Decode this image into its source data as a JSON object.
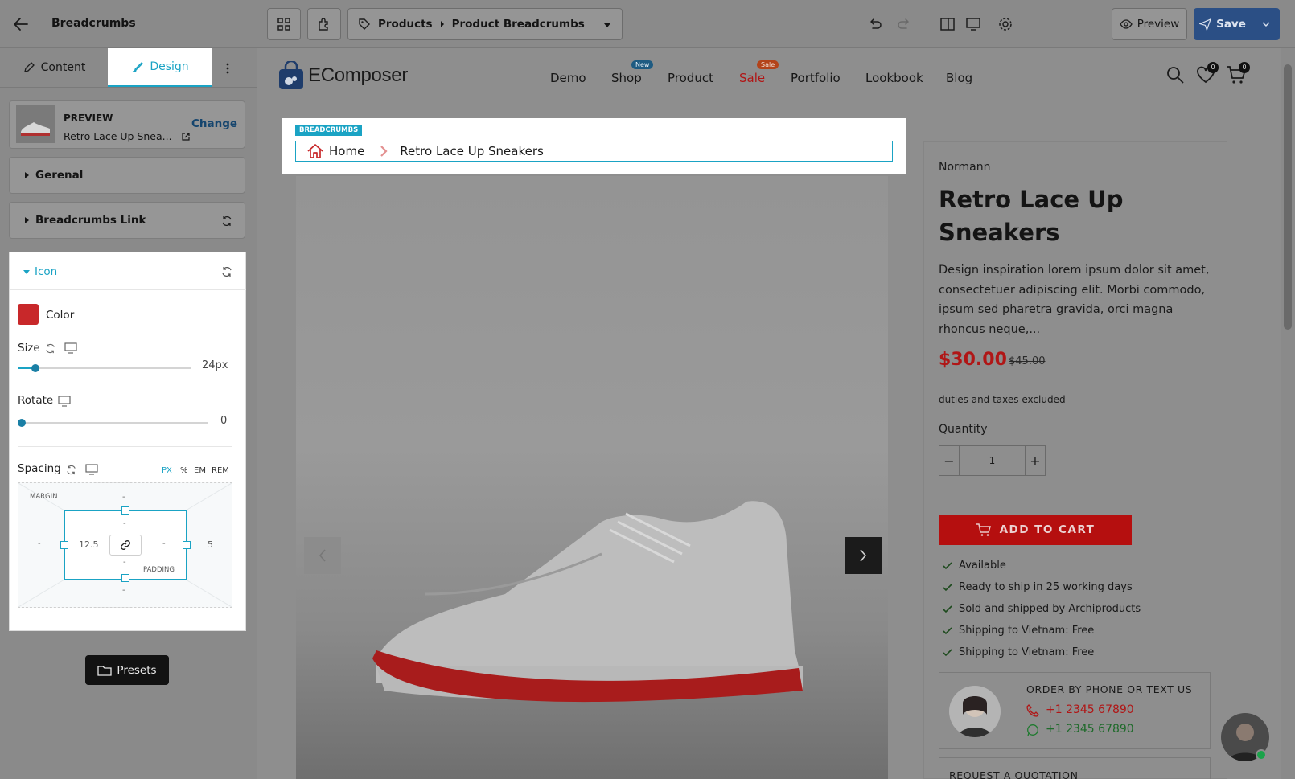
{
  "topbar": {
    "page_title": "Breadcrumbs",
    "breadcrumb_root": "Products",
    "breadcrumb_current": "Product Breadcrumbs",
    "preview_label": "Preview",
    "save_label": "Save"
  },
  "sidebar": {
    "tabs": [
      {
        "label": "Content"
      },
      {
        "label": "Design"
      }
    ],
    "preview": {
      "heading": "PREVIEW",
      "product_name": "Retro Lace Up Snea...",
      "change_label": "Change"
    },
    "sections": [
      {
        "label": "Gerenal"
      },
      {
        "label": "Breadcrumbs Link"
      },
      {
        "label": "Icon"
      }
    ],
    "icon": {
      "color_label": "Color",
      "color_value": "#c8282a",
      "size_label": "Size",
      "size_value": "24px",
      "size_fraction": 0.1,
      "rotate_label": "Rotate",
      "rotate_value": "0",
      "rotate_fraction": 0,
      "spacing_label": "Spacing",
      "units": [
        "PX",
        "%",
        "EM",
        "REM"
      ],
      "active_unit": "PX",
      "margin_label": "MARGIN",
      "padding_label": "PADDING",
      "margin_top": "-",
      "margin_bottom": "-",
      "margin_left": "-",
      "margin_right": "5",
      "padding_top": "-",
      "padding_bottom": "-",
      "padding_left": "12.5",
      "padding_right": "-"
    },
    "presets_label": "Presets"
  },
  "store": {
    "logo_text": "EComposer",
    "nav": [
      {
        "label": "Demo"
      },
      {
        "label": "Shop",
        "badge": "New"
      },
      {
        "label": "Product"
      },
      {
        "label": "Sale",
        "badge": "Sale"
      },
      {
        "label": "Portfolio"
      },
      {
        "label": "Lookbook"
      },
      {
        "label": "Blog"
      }
    ],
    "wishlist_count": "0",
    "cart_count": "0"
  },
  "breadcrumbs_widget": {
    "tag": "BREADCRUMBS",
    "home_label": "Home",
    "current_label": "Retro Lace Up Sneakers"
  },
  "product": {
    "vendor": "Normann",
    "title_line1": "Retro Lace Up",
    "title_line2": "Sneakers",
    "description": [
      "Design inspiration lorem ipsum dolor sit amet,",
      "consectetuer adipiscing elit. Morbi commodo,",
      "ipsum sed pharetra gravida, orci magna",
      "rhoncus neque,..."
    ],
    "price": "$30.00",
    "compare_price": "$45.00",
    "tax_note": "duties and taxes excluded",
    "quantity_label": "Quantity",
    "quantity_value": "1",
    "add_to_cart_label": "ADD TO CART",
    "features": [
      "Available",
      "Ready to ship in 25 working days",
      "Sold and shipped by Archiproducts",
      "Shipping to Vietnam: Free",
      "Shipping to Vietnam: Free"
    ],
    "order_heading": "ORDER BY PHONE OR TEXT US",
    "phone": "+1 2345 67890",
    "whatsapp": "+1 2345 67890",
    "quotation_label": "REQUEST A QUOTATION"
  },
  "colors": {
    "accent": "#1aa3c4",
    "icon_red": "#c8282a",
    "save_blue": "#2b4f85",
    "cart_red": "#b50f0f"
  }
}
